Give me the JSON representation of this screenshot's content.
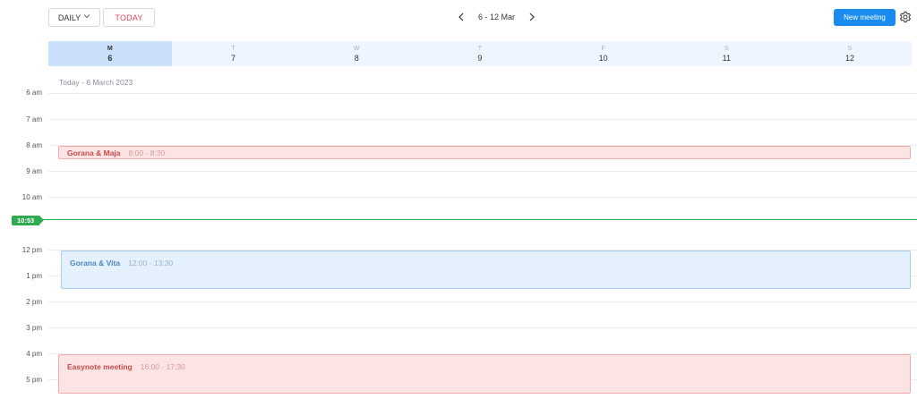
{
  "toolbar": {
    "view_label": "DAILY",
    "today_label": "TODAY",
    "range_label": "6 - 12 Mar",
    "new_meeting_label": "New meeting"
  },
  "days": [
    {
      "name": "M",
      "date": "6",
      "active": true
    },
    {
      "name": "T",
      "date": "7"
    },
    {
      "name": "W",
      "date": "8"
    },
    {
      "name": "T",
      "date": "9"
    },
    {
      "name": "F",
      "date": "10"
    },
    {
      "name": "S",
      "date": "11"
    },
    {
      "name": "S",
      "date": "12"
    }
  ],
  "today_label": "Today - 6 March 2023",
  "hours": [
    "6 am",
    "7 am",
    "8 am",
    "9 am",
    "10 am",
    "12 pm",
    "1 pm",
    "2 pm",
    "3 pm",
    "4 pm",
    "5 pm"
  ],
  "current_time": "10:53",
  "events": [
    {
      "title": "Gorana & Maja",
      "time": "8:00 - 8:30",
      "color": "red"
    },
    {
      "title": "Gorana & Vita",
      "time": "12:00 - 13:30",
      "color": "blue"
    },
    {
      "title": "Easynote meeting",
      "time": "16:00 - 17:30",
      "color": "red"
    }
  ],
  "colors": {
    "accent": "#1a8cf0",
    "today_red": "#e0485c",
    "now_green": "#2fab52",
    "event_red_bg": "#fde4e4",
    "event_blue_bg": "#e4f1fd"
  }
}
